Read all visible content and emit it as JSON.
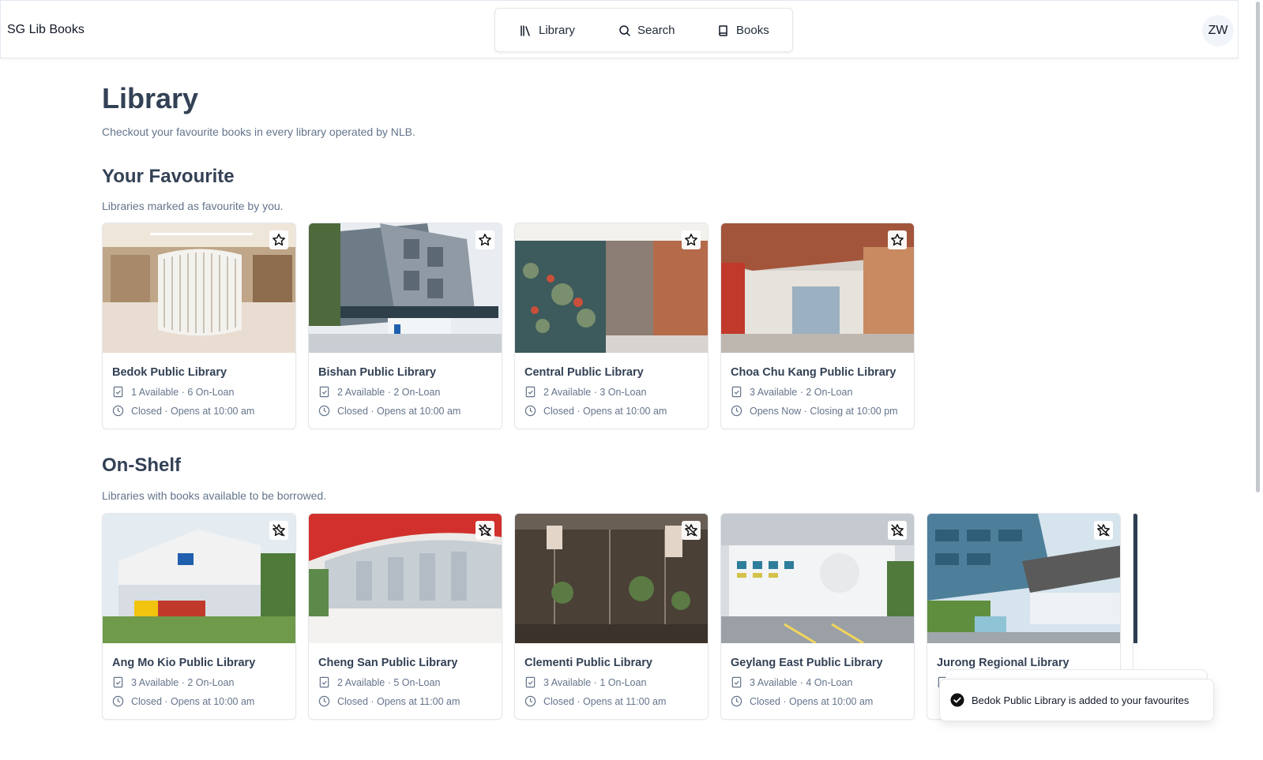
{
  "app": {
    "title": "SG Lib Books",
    "user_initials": "ZW"
  },
  "nav": {
    "items": [
      {
        "label": "Library",
        "icon": "library-icon"
      },
      {
        "label": "Search",
        "icon": "search-icon"
      },
      {
        "label": "Books",
        "icon": "book-icon"
      }
    ]
  },
  "page": {
    "title": "Library",
    "subtitle": "Checkout your favourite books in every library operated by NLB."
  },
  "favourites": {
    "title": "Your Favourite",
    "subtitle": "Libraries marked as favourite by you.",
    "cards": [
      {
        "name": "Bedok Public Library",
        "availability": "1 Available · 6 On-Loan",
        "hours": "Closed · Opens at 10:00 am",
        "favourite": true
      },
      {
        "name": "Bishan Public Library",
        "availability": "2 Available · 2 On-Loan",
        "hours": "Closed · Opens at 10:00 am",
        "favourite": true
      },
      {
        "name": "Central Public Library",
        "availability": "2 Available · 3 On-Loan",
        "hours": "Closed · Opens at 10:00 am",
        "favourite": true
      },
      {
        "name": "Choa Chu Kang Public Library",
        "availability": "3 Available · 2 On-Loan",
        "hours": "Opens Now · Closing at 10:00 pm",
        "favourite": true
      }
    ]
  },
  "on_shelf": {
    "title": "On-Shelf",
    "subtitle": "Libraries with books available to be borrowed.",
    "cards": [
      {
        "name": "Ang Mo Kio Public Library",
        "availability": "3 Available · 2 On-Loan",
        "hours": "Closed · Opens at 10:00 am",
        "favourite": false
      },
      {
        "name": "Cheng San Public Library",
        "availability": "2 Available · 5 On-Loan",
        "hours": "Closed · Opens at 11:00 am",
        "favourite": false
      },
      {
        "name": "Clementi Public Library",
        "availability": "3 Available · 1 On-Loan",
        "hours": "Closed · Opens at 11:00 am",
        "favourite": false
      },
      {
        "name": "Geylang East Public Library",
        "availability": "3 Available · 4 On-Loan",
        "hours": "Closed · Opens at 10:00 am",
        "favourite": false
      },
      {
        "name": "Jurong Regional Library",
        "availability": "",
        "hours": "",
        "favourite": false
      }
    ]
  },
  "toast": {
    "message": "Bedok Public Library is added to your favourites"
  }
}
